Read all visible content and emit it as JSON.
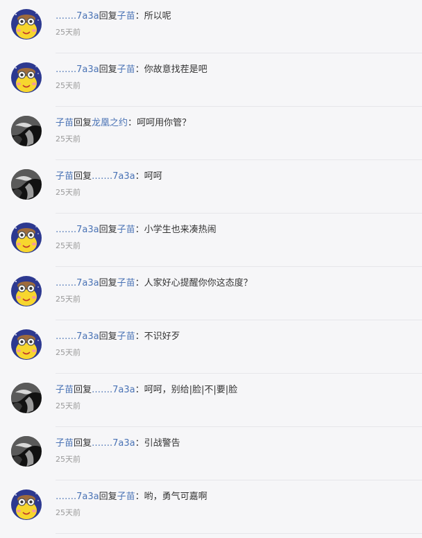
{
  "reply_word": "回复",
  "separator": "：",
  "comments": [
    {
      "author": "…….7a3a",
      "target": "子苗",
      "text": "所以呢",
      "time": "25天前",
      "avatar": "cartoon-avatar"
    },
    {
      "author": "…….7a3a",
      "target": "子苗",
      "text": "你故意找茬是吧",
      "time": "25天前",
      "avatar": "cartoon-avatar"
    },
    {
      "author": "子苗",
      "target": "龙凰之约",
      "text": "呵呵用你管？",
      "time": "25天前",
      "avatar": "bw-avatar"
    },
    {
      "author": "子苗",
      "target": "…….7a3a",
      "text": "呵呵",
      "time": "25天前",
      "avatar": "bw-avatar"
    },
    {
      "author": "…….7a3a",
      "target": "子苗",
      "text": "小学生也来凑热闹",
      "time": "25天前",
      "avatar": "cartoon-avatar"
    },
    {
      "author": "…….7a3a",
      "target": "子苗",
      "text": "人家好心提醒你你这态度？",
      "time": "25天前",
      "avatar": "cartoon-avatar"
    },
    {
      "author": "…….7a3a",
      "target": "子苗",
      "text": "不识好歹",
      "time": "25天前",
      "avatar": "cartoon-avatar"
    },
    {
      "author": "子苗",
      "target": "…….7a3a",
      "text": "呵呵，别给|脸|不|要|脸",
      "time": "25天前",
      "avatar": "bw-avatar"
    },
    {
      "author": "子苗",
      "target": "…….7a3a",
      "text": "引战警告",
      "time": "25天前",
      "avatar": "bw-avatar"
    },
    {
      "author": "…….7a3a",
      "target": "子苗",
      "text": "哟，勇气可嘉啊",
      "time": "25天前",
      "avatar": "cartoon-avatar"
    }
  ]
}
